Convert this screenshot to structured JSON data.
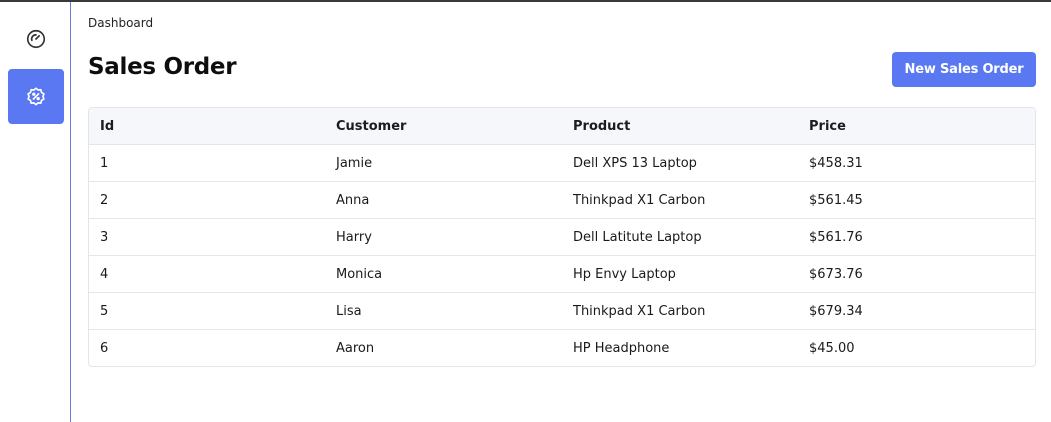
{
  "breadcrumb": "Dashboard",
  "title": "Sales Order",
  "new_button": "New Sales Order",
  "colors": {
    "accent": "#5a78f2",
    "sidebar_border": "#6a7fd1",
    "header_bg": "#f6f7fb"
  },
  "sidebar": {
    "items": [
      {
        "icon": "speedometer-icon",
        "active": false
      },
      {
        "icon": "discount-badge-icon",
        "active": true
      }
    ]
  },
  "table": {
    "columns": [
      "Id",
      "Customer",
      "Product",
      "Price"
    ],
    "rows": [
      [
        "1",
        "Jamie",
        "Dell XPS 13 Laptop",
        "$458.31"
      ],
      [
        "2",
        "Anna",
        "Thinkpad X1 Carbon",
        "$561.45"
      ],
      [
        "3",
        "Harry",
        "Dell Latitute Laptop",
        "$561.76"
      ],
      [
        "4",
        "Monica",
        "Hp Envy Laptop",
        "$673.76"
      ],
      [
        "5",
        "Lisa",
        "Thinkpad X1 Carbon",
        "$679.34"
      ],
      [
        "6",
        "Aaron",
        "HP Headphone",
        "$45.00"
      ]
    ]
  }
}
